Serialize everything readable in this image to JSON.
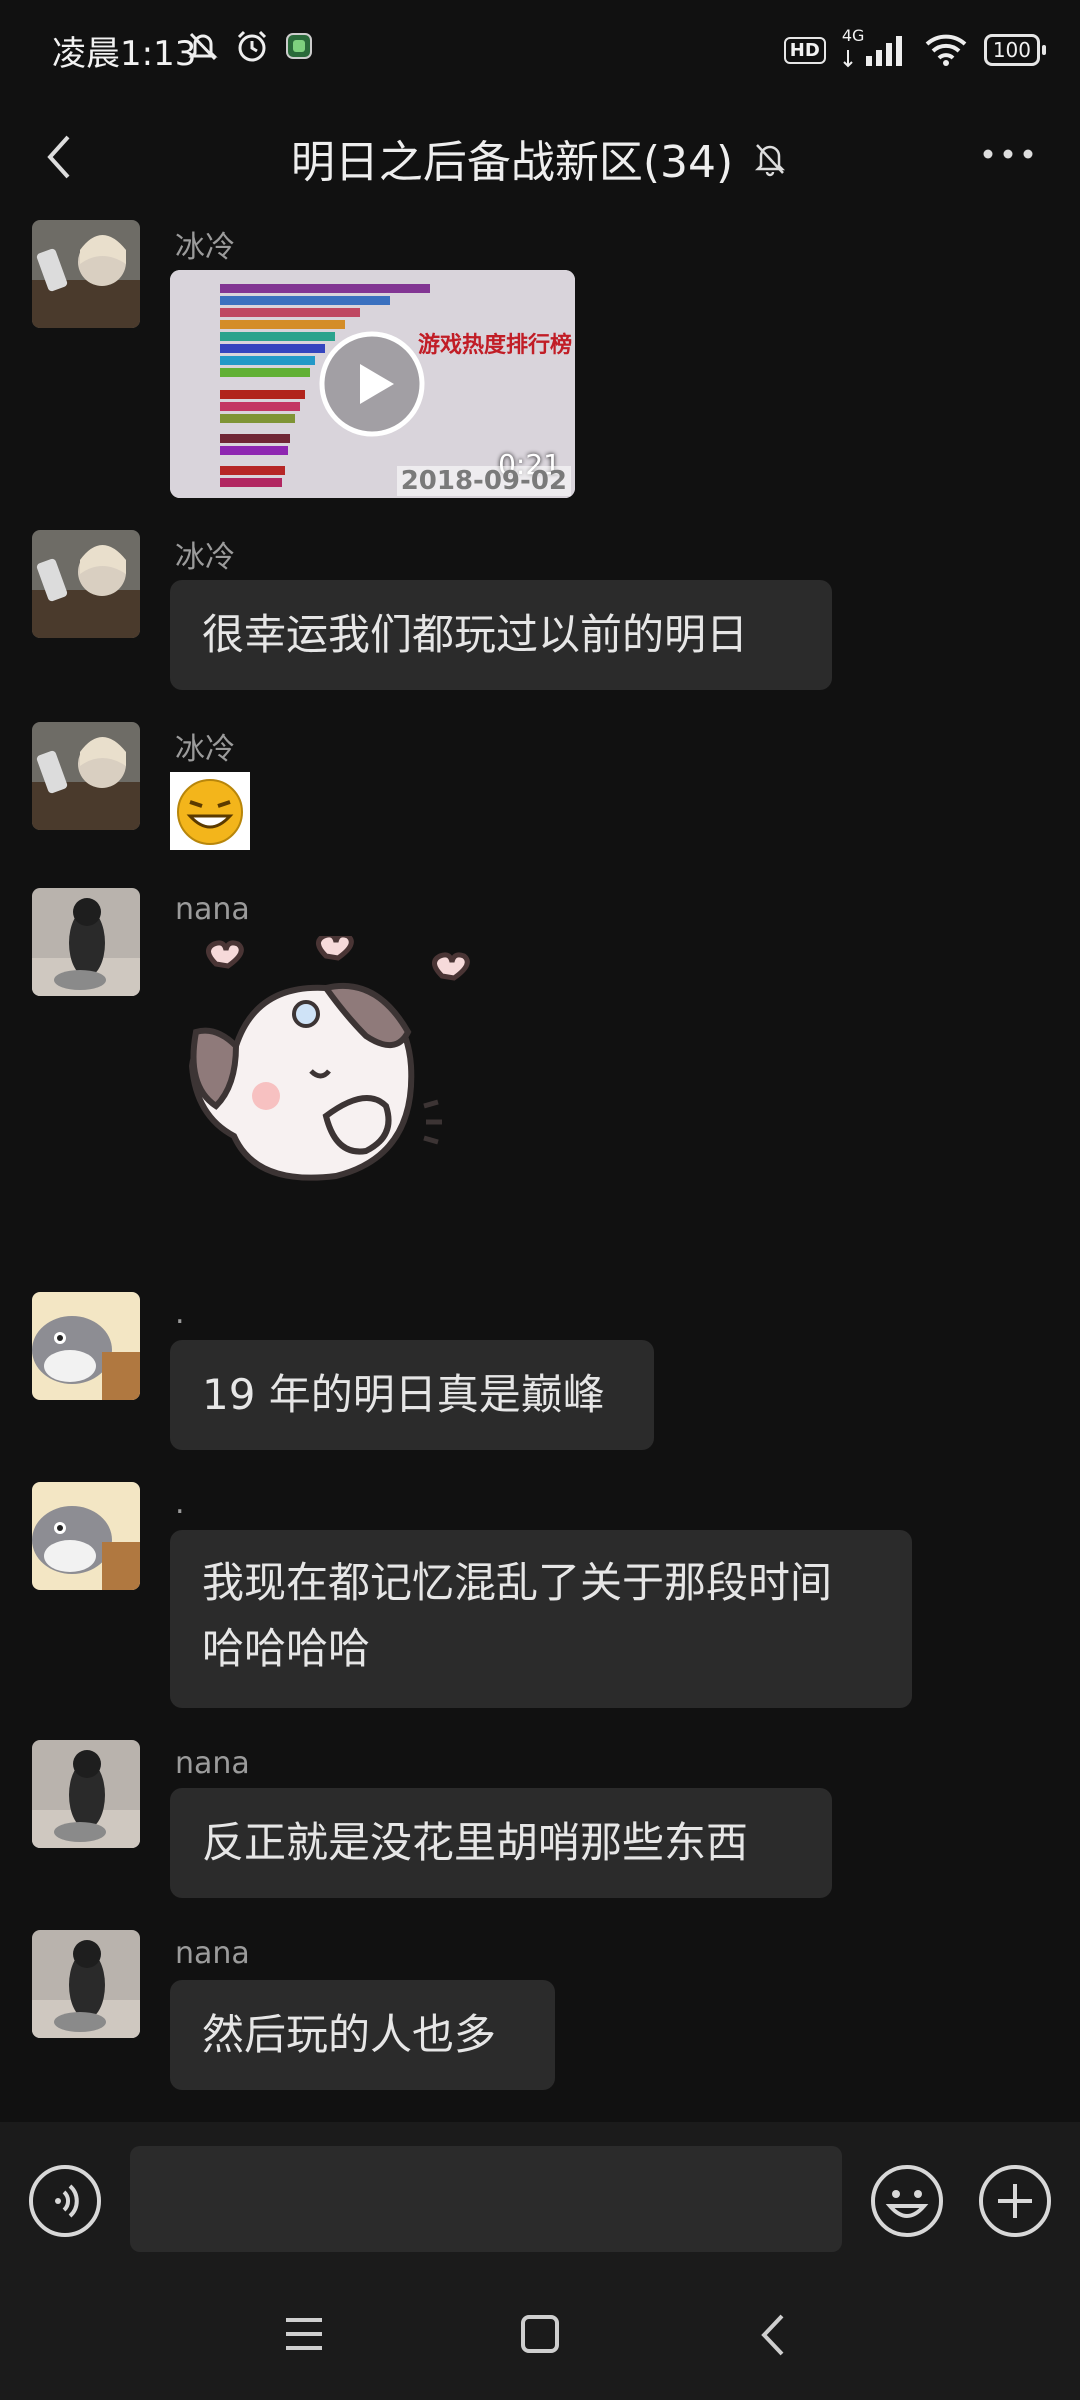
{
  "status": {
    "time": "凌晨1:13",
    "hd": "HD",
    "network": "4G",
    "battery": "100"
  },
  "header": {
    "title": "明日之后备战新区(34)"
  },
  "video": {
    "duration": "0:21",
    "date": "2018-09-02",
    "overlay_text": "游戏热度排行榜"
  },
  "messages": [
    {
      "sender": "冰冷",
      "type": "video"
    },
    {
      "sender": "冰冷",
      "type": "text",
      "text": "很幸运我们都玩过以前的明日"
    },
    {
      "sender": "冰冷",
      "type": "emoji"
    },
    {
      "sender": "nana",
      "type": "sticker"
    },
    {
      "sender": ".",
      "type": "text",
      "text": "19 年的明日真是巅峰"
    },
    {
      "sender": ".",
      "type": "text",
      "lines": [
        "我现在都记忆混乱了关于那段时间",
        "哈哈哈哈"
      ]
    },
    {
      "sender": "nana",
      "type": "text",
      "text": "反正就是没花里胡哨那些东西"
    },
    {
      "sender": "nana",
      "type": "text",
      "text": "然后玩的人也多"
    }
  ],
  "colors": {
    "background": "#111111",
    "bubble": "#2b2b2b",
    "name": "#9b9b9b",
    "text": "#e6e6e6",
    "input_bar": "#1b1b1b"
  }
}
